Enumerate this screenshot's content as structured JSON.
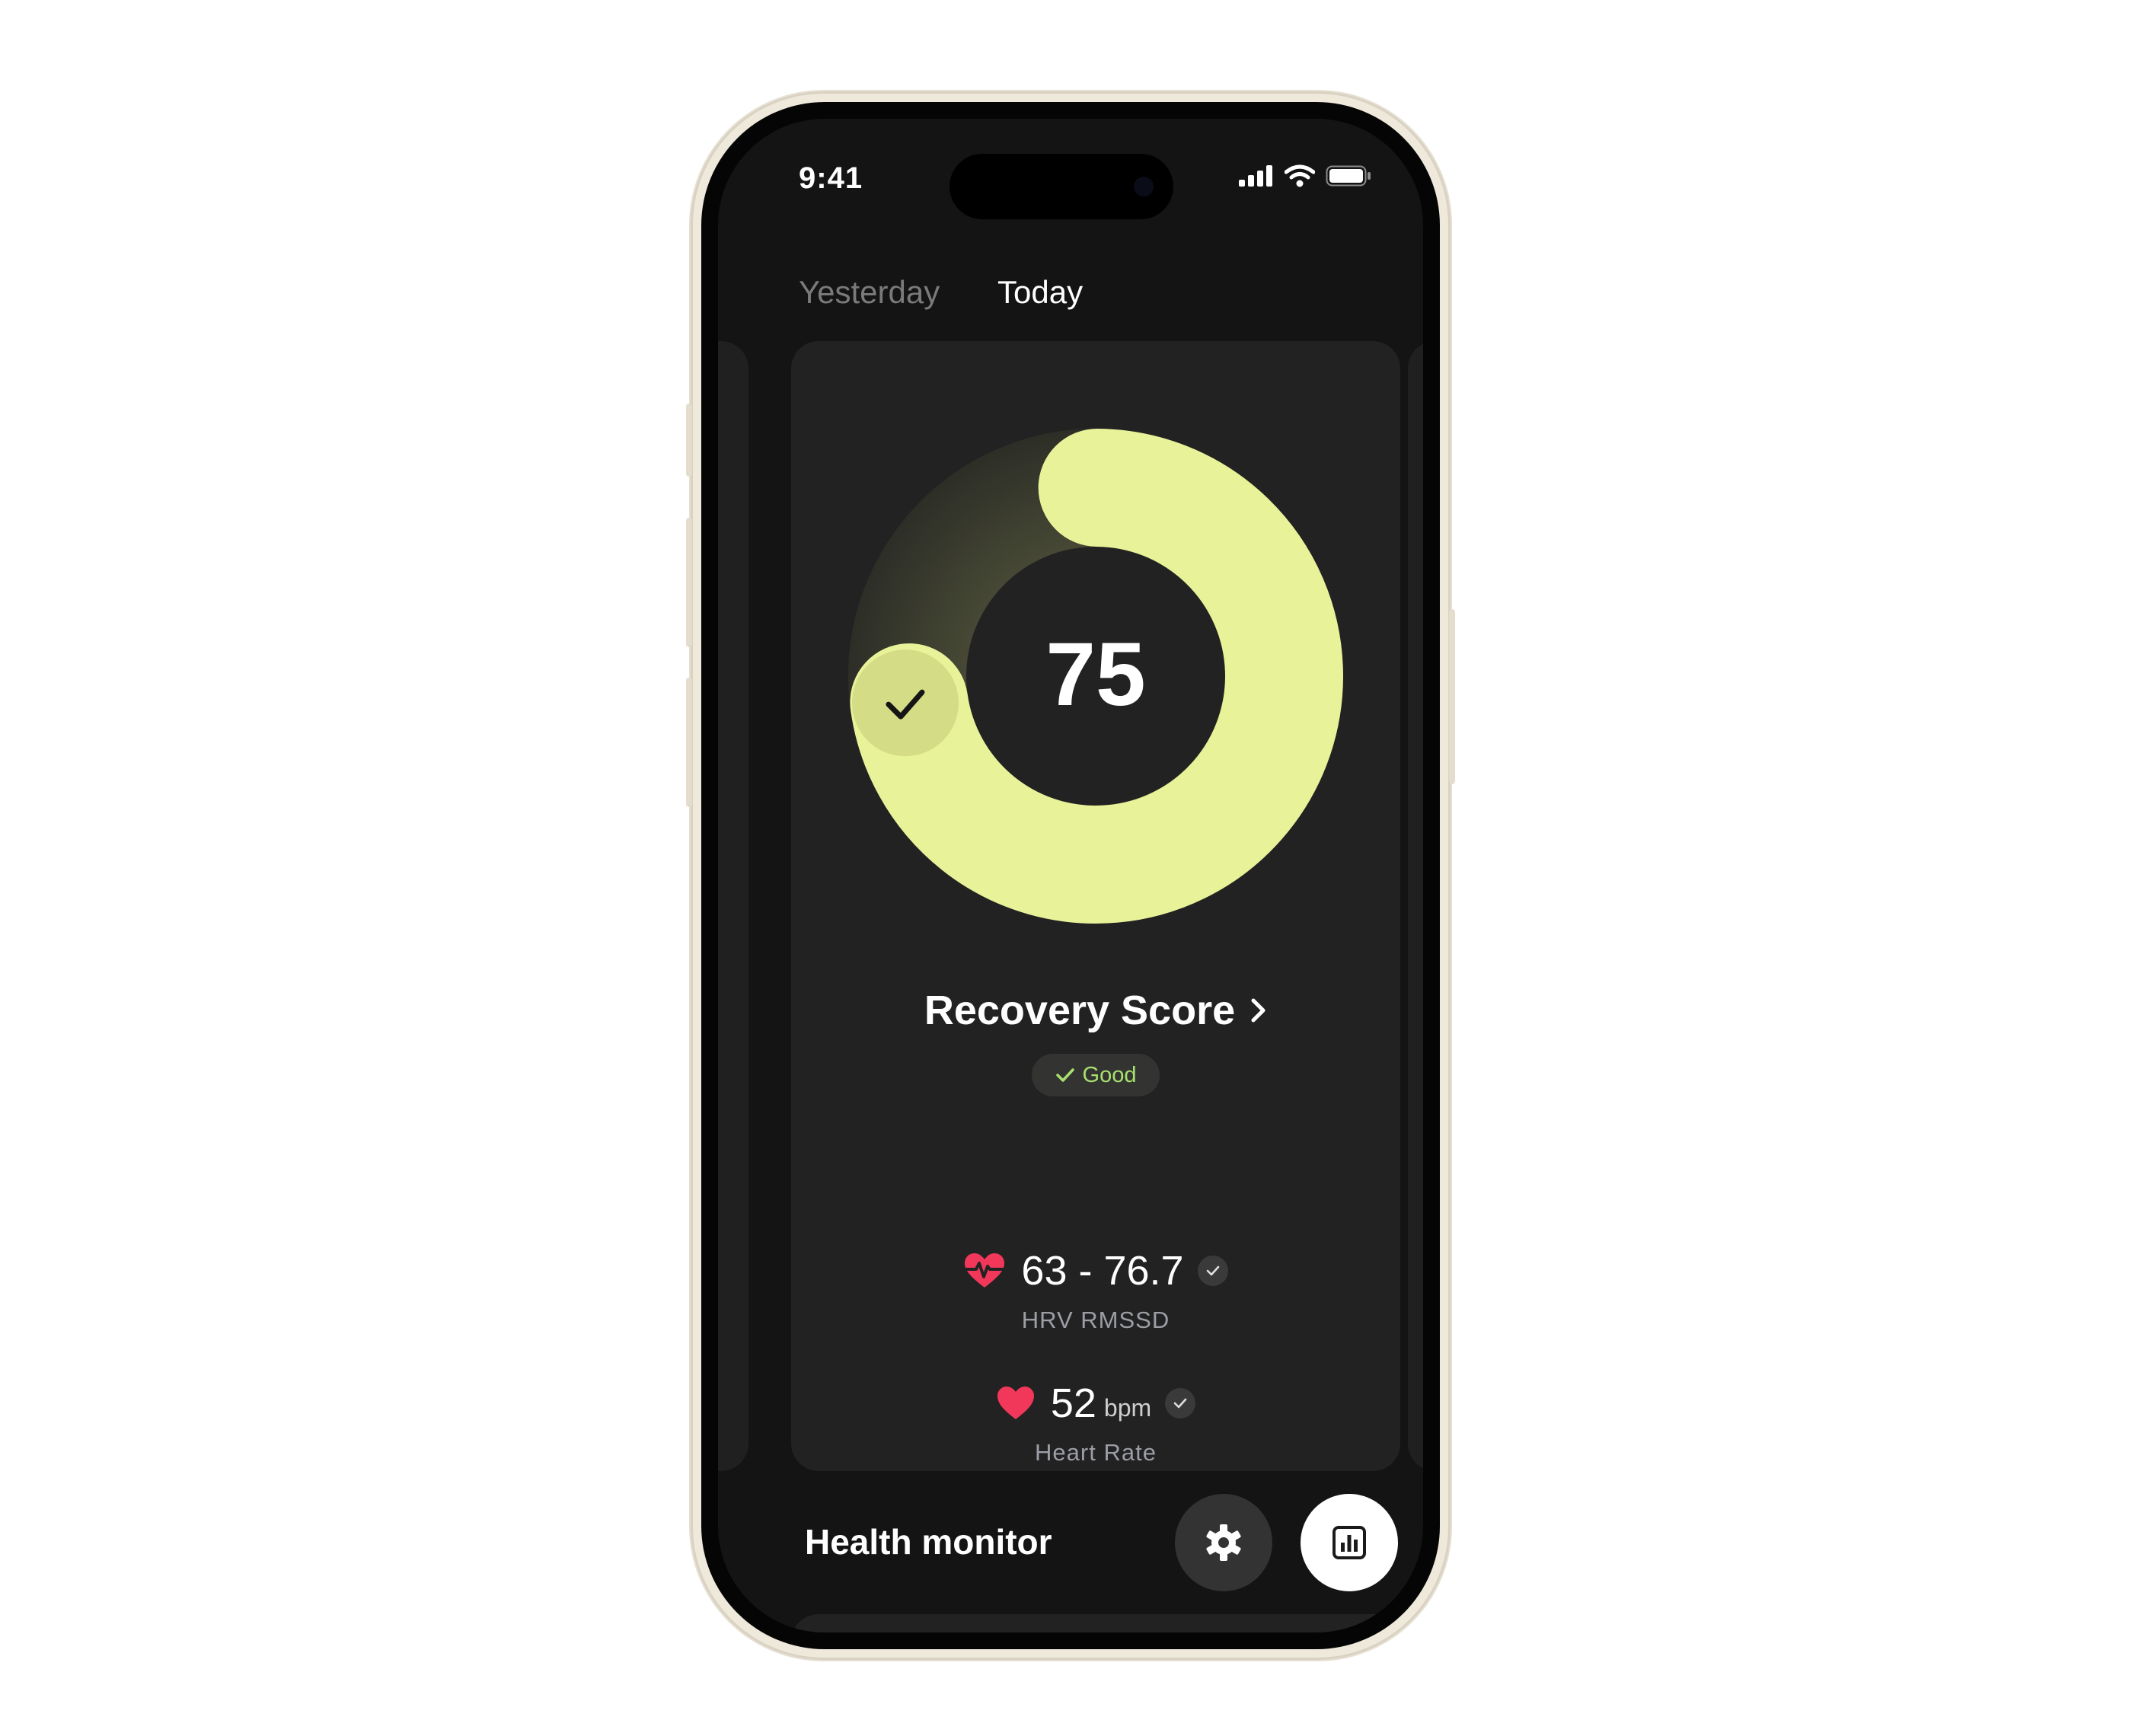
{
  "status_bar": {
    "time": "9:41"
  },
  "tabs": [
    {
      "label": "Yesterday",
      "active": false
    },
    {
      "label": "Today",
      "active": true
    }
  ],
  "recovery": {
    "score": "75",
    "score_fraction": 0.75,
    "title": "Recovery Score",
    "status": "Good",
    "ring_color": "#e8f298",
    "status_color": "#a8e06e"
  },
  "metrics": {
    "hrv": {
      "value": "63 - 76.7",
      "label": "HRV RMSSD"
    },
    "heart_rate": {
      "value": "52",
      "unit": "bpm",
      "label": "Heart Rate"
    },
    "accent_color": "#f2385a"
  },
  "section": {
    "title": "Health monitor"
  },
  "icons": {
    "settings": "gear-icon",
    "stats": "bar-chart-icon",
    "hrv": "heart-pulse-icon",
    "heart_rate": "heart-icon"
  }
}
